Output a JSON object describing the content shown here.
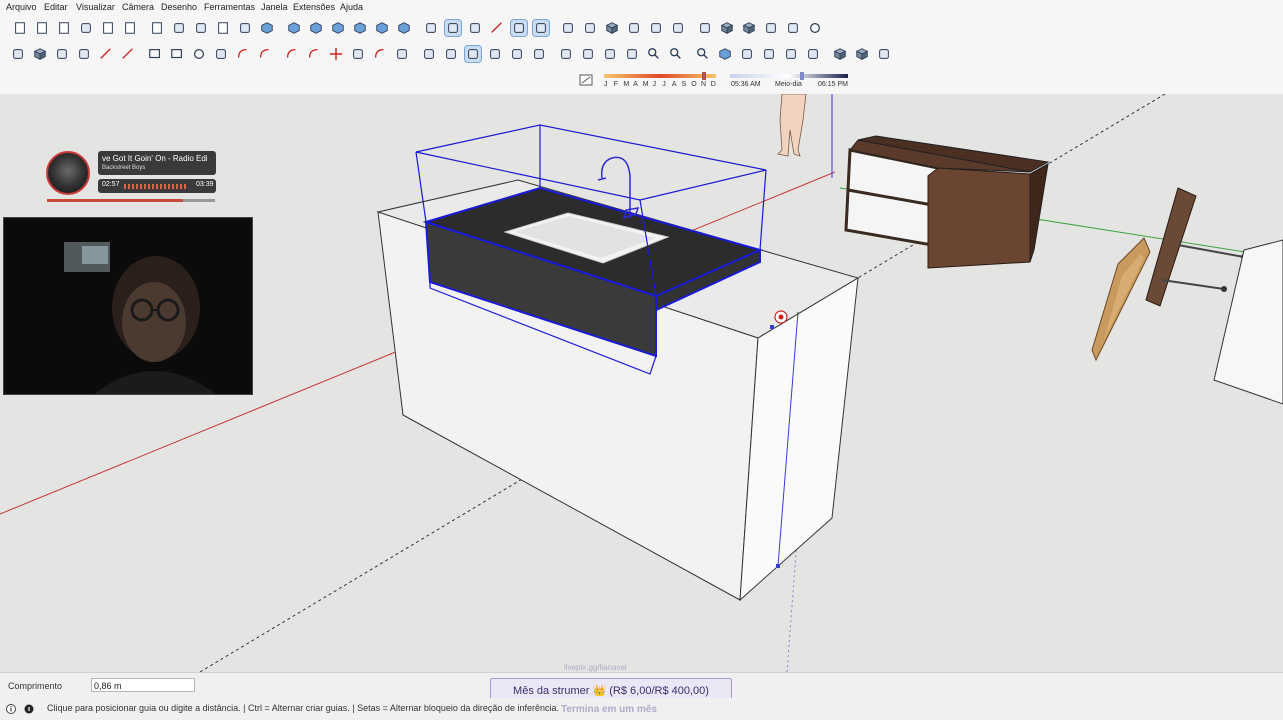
{
  "menu": [
    "Arquivo",
    "Editar",
    "Visualizar",
    "Câmera",
    "Desenho",
    "Ferramentas",
    "Janela",
    "Extensões",
    "Ajuda"
  ],
  "shadow_bar": {
    "months": [
      "J",
      "F",
      "M",
      "A",
      "M",
      "J",
      "J",
      "A",
      "S",
      "O",
      "N",
      "D"
    ],
    "time_start": "05:36 AM",
    "time_mid": "Meio-dia",
    "time_end": "06:15 PM"
  },
  "music_widget": {
    "title": "ve Got It Goin' On - Radio Edi",
    "artist": "Backstreet Boys",
    "elapsed": "02:57",
    "total": "03:39",
    "progress": 0.81
  },
  "measurements": {
    "label": "Comprimento",
    "value": "0,86 m"
  },
  "goal": {
    "text": "Mês da strumer 👑 (R$ 6,00/R$ 400,00)",
    "url": "livepix.gg/lianavel",
    "ends": "Termina em um mês",
    "current": 6,
    "target": 400
  },
  "status_hint": "Clique para posicionar guia ou digite a distância.  |  Ctrl = Alternar criar guias.  |  Setas = Alternar bloqueio da direção de inferência.",
  "colors": {
    "selection": "#1a1ad6",
    "axis_red": "#c8383a",
    "axis_green": "#3ea33e",
    "background": "#e4e4e2",
    "wood_dark": "#5b3b2a",
    "wood_light": "#c89a5e",
    "granite": "#2a2a2a",
    "goal_accent": "#a99ad6"
  },
  "toolbar_icons_row1": [
    "new-file-icon",
    "open-folder-icon",
    "save-icon",
    "cut-icon",
    "copy-icon",
    "paste-icon",
    "delete-icon",
    "undo-icon",
    "redo-icon",
    "print-icon",
    "model-info-icon",
    "iso-view-icon",
    "top-view-icon",
    "front-view-icon",
    "right-view-icon",
    "back-view-icon",
    "left-view-icon",
    "bottom-view-icon",
    "xray-icon",
    "back-edges-icon",
    "wireframe-icon",
    "hidden-line-icon",
    "shaded-icon",
    "textured-icon",
    "monochrome-icon",
    "section-plane-icon",
    "components-icon",
    "materials-icon",
    "styles-icon",
    "layers-icon",
    "scenes-icon",
    "extension-warehouse-icon",
    "3d-warehouse-icon",
    "trimble-connect-icon",
    "extension-manager-icon",
    "user-account-icon"
  ],
  "toolbar_icons_row2": [
    "select-icon",
    "component-icon",
    "paint-bucket-icon",
    "eraser-icon",
    "line-icon",
    "freehand-icon",
    "rectangle-icon",
    "rotated-rectangle-icon",
    "circle-icon",
    "polygon-icon",
    "arc-icon",
    "two-point-arc-icon",
    "three-point-arc-icon",
    "pie-icon",
    "move-icon",
    "push-pull-icon",
    "rotate-icon",
    "follow-me-icon",
    "scale-icon",
    "offset-icon",
    "tape-measure-icon",
    "dimension-icon",
    "protractor-icon",
    "text-icon",
    "axes-icon",
    "3d-text-icon",
    "orbit-icon",
    "pan-icon",
    "zoom-icon",
    "zoom-window-icon",
    "zoom-extents-icon",
    "previous-view-icon",
    "position-camera-icon",
    "look-around-icon",
    "walk-icon",
    "section-icon",
    "solid-tools-icon",
    "sandbox-icon",
    "shadows-icon"
  ]
}
